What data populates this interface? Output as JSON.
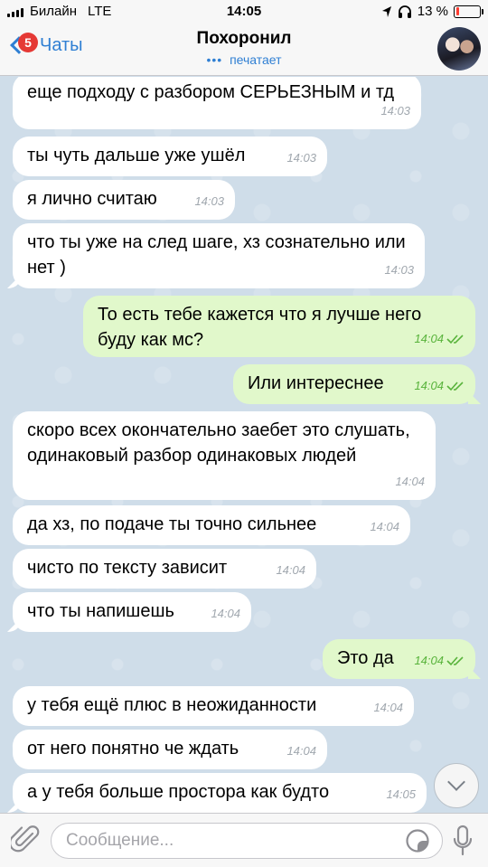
{
  "status_bar": {
    "carrier": "Билайн",
    "network": "LTE",
    "time": "14:05",
    "battery_text": "13 %",
    "battery_level": 0.13
  },
  "header": {
    "back_label": "Чаты",
    "unread_badge": "5",
    "title": "Похоронил",
    "status": "печатает"
  },
  "messages": [
    {
      "dir": "in",
      "text": "еще подходу с разбором СЕРЬЕЗНЫМ и тд",
      "time": "14:03"
    },
    {
      "dir": "in",
      "text": "ты чуть дальше уже ушёл",
      "time": "14:03"
    },
    {
      "dir": "in",
      "text": "я лично считаю",
      "time": "14:03"
    },
    {
      "dir": "in",
      "text": "что ты уже на след шаге, хз сознательно или нет )",
      "time": "14:03"
    },
    {
      "dir": "out",
      "text": "То есть тебе кажется что я лучше него буду как мс?",
      "time": "14:04"
    },
    {
      "dir": "out",
      "text": "Или интереснее",
      "time": "14:04"
    },
    {
      "dir": "in",
      "text": "скоро всех окончательно заебет это слушать, одинаковый разбор одинаковых людей",
      "time": "14:04"
    },
    {
      "dir": "in",
      "text": "да хз, по подаче ты точно сильнее",
      "time": "14:04"
    },
    {
      "dir": "in",
      "text": "чисто по тексту зависит",
      "time": "14:04"
    },
    {
      "dir": "in",
      "text": "что ты напишешь",
      "time": "14:04"
    },
    {
      "dir": "out",
      "text": "Это да",
      "time": "14:04"
    },
    {
      "dir": "in",
      "text": "у тебя ещё плюс в неожиданности",
      "time": "14:04"
    },
    {
      "dir": "in",
      "text": "от него понятно че ждать",
      "time": "14:04"
    },
    {
      "dir": "in",
      "text": "а у тебя больше простора как будто",
      "time": "14:05"
    }
  ],
  "input": {
    "placeholder": "Сообщение..."
  },
  "colors": {
    "accent": "#2f7fd3",
    "outgoing_bubble": "#e1f8cb",
    "incoming_bubble": "#ffffff",
    "read_ticks": "#58b33b",
    "badge": "#e53935",
    "chat_background": "#cfdde9"
  },
  "icons": {
    "back": "chevron-left-icon",
    "attach": "paperclip-icon",
    "sticker": "sticker-icon",
    "mic": "microphone-icon",
    "scroll_down": "chevron-down-icon",
    "read_receipt": "double-check-icon"
  }
}
